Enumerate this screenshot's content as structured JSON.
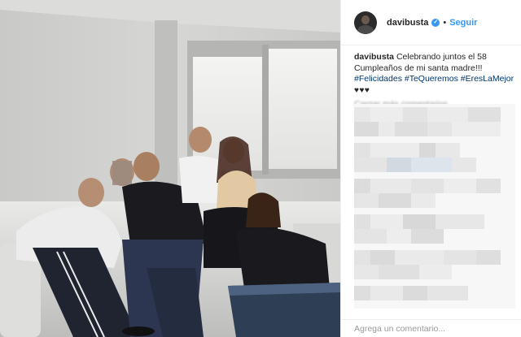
{
  "post": {
    "author": {
      "username": "davibusta",
      "verified": true,
      "verified_icon": "verified-badge-icon",
      "separator": "•",
      "follow_label": "Seguir"
    },
    "caption": {
      "username": "davibusta",
      "text": "Celebrando juntos el 58 Cumpleaños de mi santa madre!!!",
      "hashtags": [
        "#Felicidades",
        "#TeQueremos",
        "#EresLaMejor"
      ],
      "hearts": "♥♥♥"
    },
    "comments": {
      "load_more_label": "Cargar más comentarios"
    },
    "add_comment": {
      "placeholder": "Agrega un comentario..."
    },
    "colors": {
      "link_blue": "#3897f0",
      "hashtag_blue": "#003569",
      "text": "#262626",
      "muted": "#999999",
      "border": "#efefef"
    }
  }
}
